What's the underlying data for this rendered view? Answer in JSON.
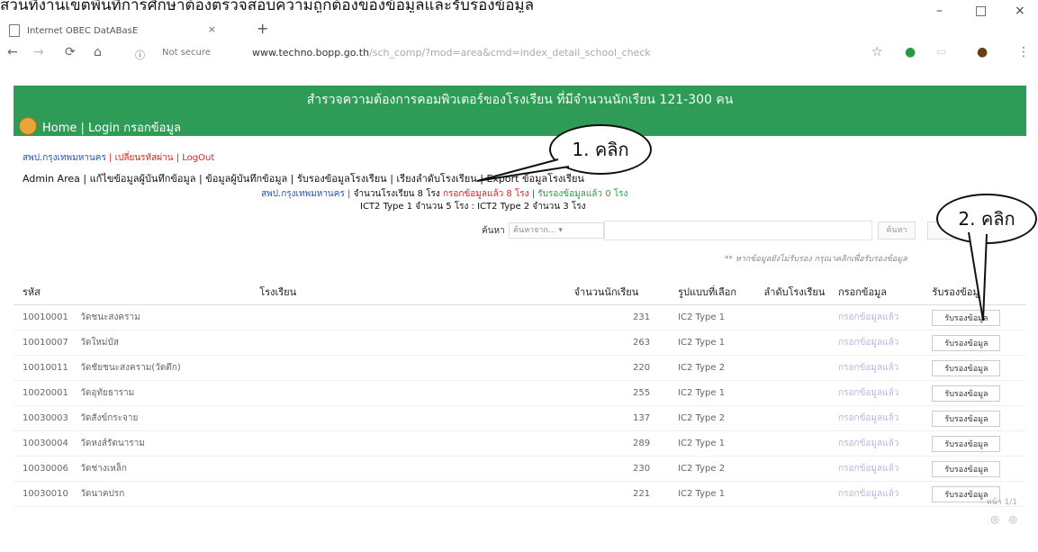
{
  "heading": "ส่วนที่งานเขตพื้นที่การศึกษาต้องตรวจสอบความถูกต้องของข้อมูลและรับรองข้อมูล",
  "browser": {
    "tab_title": "Internet OBEC DatABasE",
    "new_tab": "+",
    "security": "Not secure",
    "url_host": "www.techno.bopp.go.th",
    "url_path": "/sch_comp/?mod=area&cmd=index_detail_school_check",
    "window_controls": [
      "–",
      "□",
      "×"
    ]
  },
  "page": {
    "banner": "สำรวจความต้องการคอมพิวเตอร์ของโรงเรียน ที่มีจำนวนนักเรียน 121-300 คน",
    "home": "Home",
    "login": "Login กรอกข้อมูล",
    "org_links": [
      "สพป.กรุงเทพมหานคร",
      "เปลี่ยนรหัสผ่าน",
      "LogOut"
    ],
    "admin_menu": [
      "Admin Area",
      "แก้ไขข้อมูลผู้บันทึกข้อมูล",
      "ข้อมูลผู้บันทึกข้อมูล",
      "รับรองข้อมูลโรงเรียน",
      "เรียงลำดับโรงเรียน",
      "Export ข้อมูลโรงเรียน"
    ],
    "summary_line1": {
      "area": "สพป.กรุงเทพมหานคร",
      "total": "จำนวนโรงเรียน 8 โรง",
      "filled": "กรอกข้อมูลแล้ว 8 โรง",
      "approved": "รับรองข้อมูลแล้ว 0 โรง"
    },
    "summary_line2": "ICT2 Type 1 จำนวน 5 โรง  :  ICT2 Type 2 จำนวน 3 โรง",
    "search_label": "ค้นหา :",
    "search_select": "ค้นหาจาก...",
    "search_button": "ค้นหา",
    "note": "** หากข้อมูลยังไม่รับรอง กรุณาคลิกเพื่อรับรองข้อมูล",
    "table": {
      "headers": [
        "รหัส",
        "โรงเรียน",
        "จำนวนนักเรียน",
        "รูปแบบที่เลือก",
        "ลำดับโรงเรียน",
        "กรอกข้อมูล",
        "รับรองข้อมูล"
      ],
      "rows": [
        [
          "10010001",
          "วัดชนะสงคราม",
          "231",
          "IC2 Type 1",
          "",
          "กรอกข้อมูลแล้ว",
          "รับรองข้อมูล"
        ],
        [
          "10010007",
          "วัดใหม่บัส",
          "263",
          "IC2 Type 1",
          "",
          "กรอกข้อมูลแล้ว",
          "รับรองข้อมูล"
        ],
        [
          "10010011",
          "วัดชัยชนะสงคราม(วัดตึก)",
          "220",
          "IC2 Type 2",
          "",
          "กรอกข้อมูลแล้ว",
          "รับรองข้อมูล"
        ],
        [
          "10020001",
          "วัดอุทัยธาราม",
          "255",
          "IC2 Type 1",
          "",
          "กรอกข้อมูลแล้ว",
          "รับรองข้อมูล"
        ],
        [
          "10030003",
          "วัดสังข์กระจาย",
          "137",
          "IC2 Type 2",
          "",
          "กรอกข้อมูลแล้ว",
          "รับรองข้อมูล"
        ],
        [
          "10030004",
          "วัดหงส์รัตนาราม",
          "289",
          "IC2 Type 1",
          "",
          "กรอกข้อมูลแล้ว",
          "รับรองข้อมูล"
        ],
        [
          "10030006",
          "วัดช่างเหล็ก",
          "230",
          "IC2 Type 2",
          "",
          "กรอกข้อมูลแล้ว",
          "รับรองข้อมูล"
        ],
        [
          "10030010",
          "วัดนาคปรก",
          "221",
          "IC2 Type 1",
          "",
          "กรอกข้อมูลแล้ว",
          "รับรองข้อมูล"
        ]
      ]
    },
    "pager": "หน้า 1/1"
  },
  "callouts": {
    "one": "1. คลิก",
    "two": "2. คลิก"
  },
  "colors": {
    "banner": "#2e9c57",
    "link_blue": "#2b50b2",
    "link_red": "#d22"
  }
}
